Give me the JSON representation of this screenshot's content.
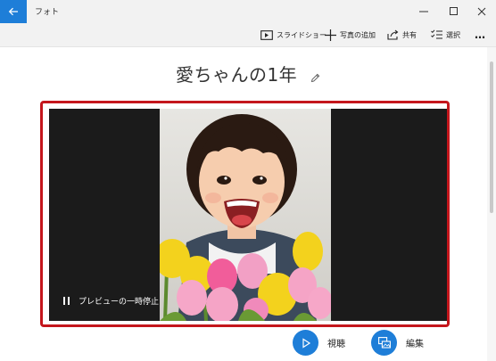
{
  "window": {
    "app_title": "フォト",
    "back_icon": "back-arrow-icon",
    "controls": [
      "minimize-icon",
      "maximize-icon",
      "close-icon"
    ]
  },
  "toolbar": {
    "slideshow_label": "スライドショー",
    "add_photos_label": "写真の追加",
    "share_label": "共有",
    "select_label": "選択",
    "more_label": "…"
  },
  "album": {
    "title": "愛ちゃんの1年",
    "edit_icon": "pencil-icon"
  },
  "preview": {
    "pause_label": "プレビューの一時停止",
    "pause_icon": "pause-icon",
    "image_desc": "girl-with-tulips"
  },
  "actions": {
    "watch_label": "視聴",
    "edit_label": "編集"
  },
  "colors": {
    "accent": "#1e7ed8",
    "highlight_border": "#c4161c",
    "video_bg": "#1b1b1b"
  }
}
